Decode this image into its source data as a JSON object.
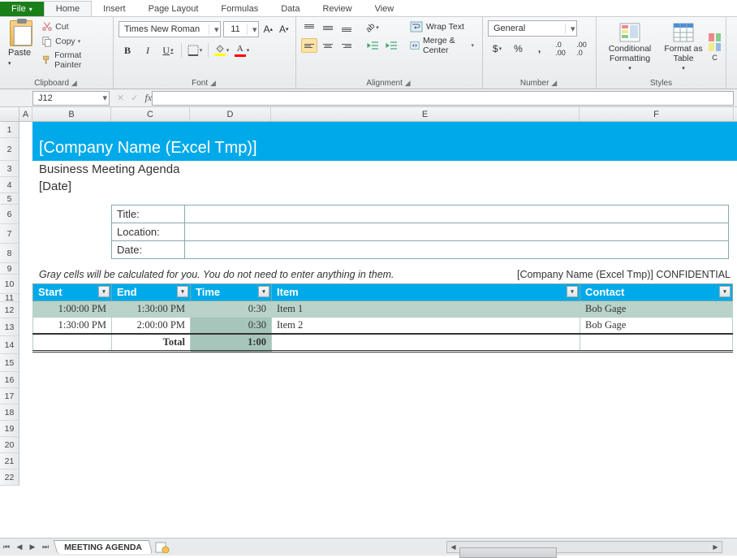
{
  "tabs": {
    "file": "File",
    "home": "Home",
    "insert": "Insert",
    "pagelayout": "Page Layout",
    "formulas": "Formulas",
    "data": "Data",
    "review": "Review",
    "view": "View"
  },
  "clipboard": {
    "paste": "Paste",
    "cut": "Cut",
    "copy": "Copy",
    "fmtpainter": "Format Painter",
    "group": "Clipboard"
  },
  "font": {
    "name": "Times New Roman",
    "size": "11",
    "group": "Font"
  },
  "alignment": {
    "wrap": "Wrap Text",
    "merge": "Merge & Center",
    "group": "Alignment"
  },
  "number": {
    "format": "General",
    "group": "Number"
  },
  "styles": {
    "cond": "Conditional Formatting",
    "tbl": "Format as Table",
    "cell": "C\nSty",
    "group": "Styles"
  },
  "namebox": "J12",
  "fx": "fx",
  "cols": {
    "A": "A",
    "B": "B",
    "C": "C",
    "D": "D",
    "E": "E",
    "F": "F"
  },
  "doc": {
    "company": "[Company Name (Excel Tmp)]",
    "subtitle": "Business Meeting Agenda",
    "datelbl": "[Date]",
    "fields": {
      "title": "Title:",
      "location": "Location:",
      "date": "Date:"
    },
    "note": "Gray cells will be calculated for you. You do not need to enter anything in them.",
    "conf": "[Company Name (Excel Tmp)] CONFIDENTIAL"
  },
  "agenda": {
    "hdr": {
      "start": "Start",
      "end": "End",
      "time": "Time",
      "item": "Item",
      "contact": "Contact"
    },
    "rows": [
      {
        "start": "1:00:00 PM",
        "end": "1:30:00 PM",
        "time": "0:30",
        "item": "Item 1",
        "contact": "Bob Gage"
      },
      {
        "start": "1:30:00 PM",
        "end": "2:00:00 PM",
        "time": "0:30",
        "item": "Item 2",
        "contact": "Bob Gage"
      }
    ],
    "total_lbl": "Total",
    "total": "1:00"
  },
  "sheettab": "MEETING AGENDA",
  "chart_data": null
}
